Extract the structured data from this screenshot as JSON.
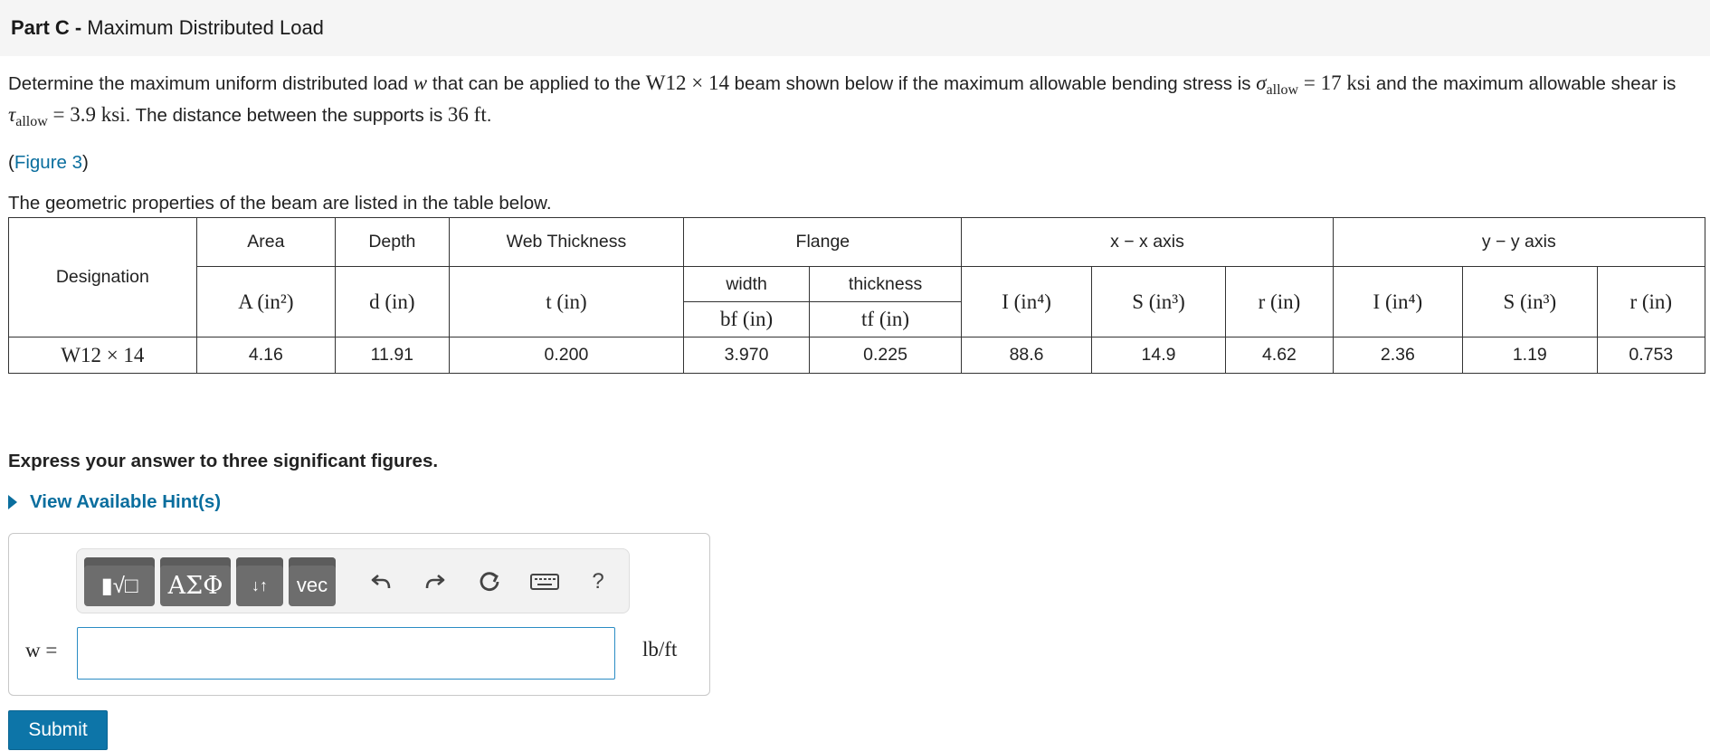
{
  "header": {
    "part_label": "Part C -",
    "part_title": "Maximum Distributed Load"
  },
  "problem": {
    "t1": "Determine the maximum uniform distributed load ",
    "w": "w",
    "t2": " that can be applied to the ",
    "designation": "W12 × 14",
    "t3": " beam shown below if the maximum allowable bending stress is ",
    "sigma": "σ",
    "allow": "allow",
    "sigma_value": " = 17 ksi",
    "t4": " and the maximum allowable shear is ",
    "tau": "τ",
    "tau_value": " = 3.9 ksi",
    "t5": ". The distance between the supports is ",
    "distance": "36 ft",
    "t6": "."
  },
  "figure_link": {
    "open": "(",
    "label": "Figure 3",
    "close": ")"
  },
  "table_caption": "The geometric properties of the beam are listed in the table below.",
  "table": {
    "designation_header": "Designation",
    "area": "Area",
    "depth": "Depth",
    "web_thickness": "Web Thickness",
    "flange": "Flange",
    "xx_axis": "x − x axis",
    "yy_axis": "y − y axis",
    "area_unit": "A (in²)",
    "depth_unit": "d (in)",
    "web_unit": "t (in)",
    "flange_width": "width",
    "flange_thickness": "thickness",
    "bf_unit": "bf (in)",
    "tf_unit": "tf (in)",
    "I_unit": "I (in⁴)",
    "S_unit": "S (in³)",
    "r_unit": "r (in)",
    "row": {
      "designation": "W12 × 14",
      "A": "4.16",
      "d": "11.91",
      "t": "0.200",
      "bf": "3.970",
      "tf": "0.225",
      "Ix": "88.6",
      "Sx": "14.9",
      "rx": "4.62",
      "Iy": "2.36",
      "Sy": "1.19",
      "ry": "0.753"
    }
  },
  "instructions": "Express your answer to three significant figures.",
  "hint_label": "View Available Hint(s)",
  "answer": {
    "variable_label": "w =",
    "value": "",
    "unit": "lb/ft",
    "toolbar": {
      "templates_label": "▮√□",
      "greek_label": "ΑΣΦ",
      "arrows_label": "↓↑",
      "vec_label": "vec",
      "help_label": "?"
    }
  },
  "submit_label": "Submit"
}
